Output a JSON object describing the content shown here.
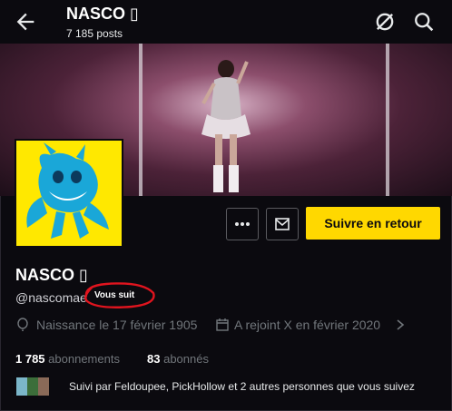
{
  "header": {
    "title": "NASCO ▯",
    "posts": "7 185 posts",
    "icons": [
      "back-arrow-icon",
      "no-sync-icon",
      "search-icon"
    ]
  },
  "profile": {
    "name": "NASCO ▯",
    "handle": "@nascoma",
    "handle_tail": "e",
    "follows_you": "Vous suit",
    "birth": "Naissance le 17 février 1905",
    "joined": "A rejoint X en février 2020",
    "following_count": "1 785",
    "following_label": "abonnements",
    "followers_count": "83",
    "followers_label": "abonnés",
    "followed_by": "Suivi par Feldoupee, PickHollow et 2 autres personnes que vous suivez"
  },
  "actions": {
    "follow_back": "Suivre en retour"
  },
  "colors": {
    "accent": "#ffd800",
    "background": "#0b0a0f",
    "annotation": "#e0141e"
  }
}
